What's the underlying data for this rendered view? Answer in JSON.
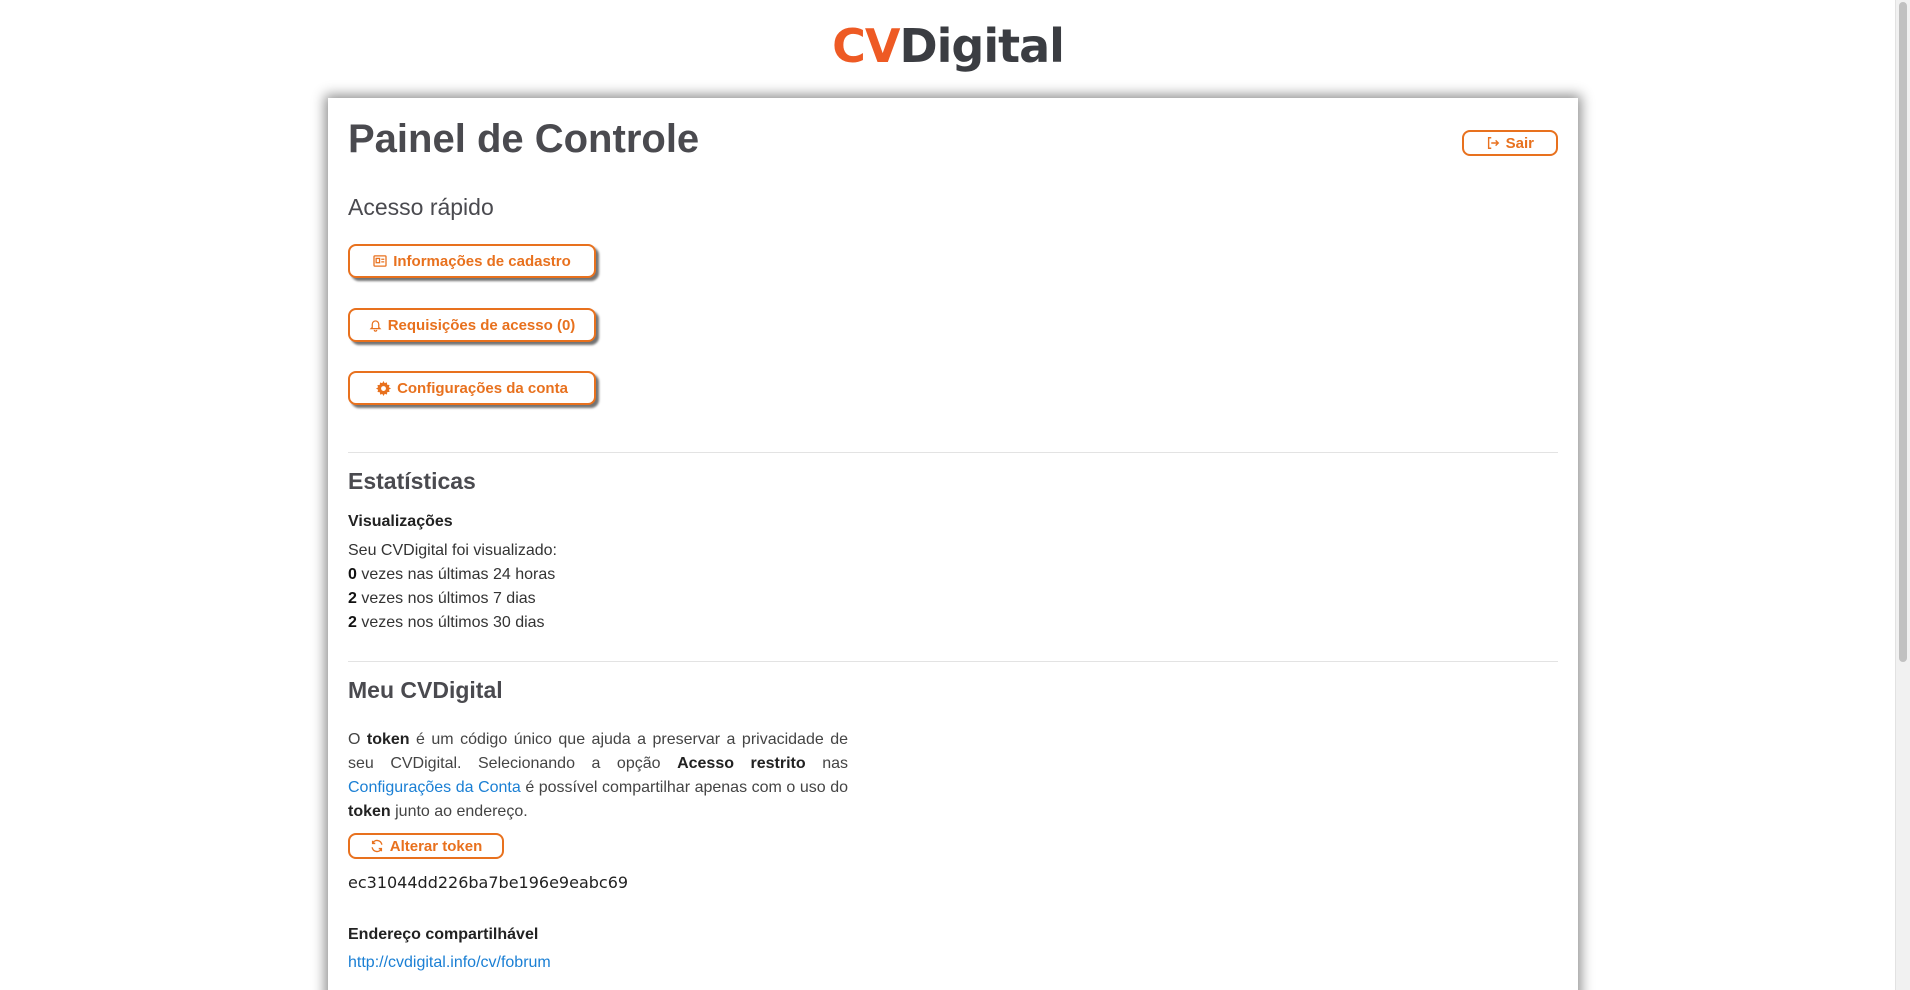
{
  "logo": {
    "part1": "CV",
    "part2": "Digital"
  },
  "header": {
    "title": "Painel de Controle",
    "logout_label": "Sair"
  },
  "quick_access": {
    "title": "Acesso rápido",
    "buttons": [
      {
        "label": "Informações de cadastro",
        "icon": "id-card-icon"
      },
      {
        "label": "Requisições de acesso (0)",
        "icon": "bell-icon"
      },
      {
        "label": "Configurações da conta",
        "icon": "gear-icon"
      }
    ]
  },
  "stats": {
    "title": "Estatísticas",
    "views_label": "Visualizações",
    "intro": "Seu CVDigital foi visualizado:",
    "rows": [
      {
        "count": "0",
        "text": " vezes nas últimas 24 horas"
      },
      {
        "count": "2",
        "text": " vezes nos últimos 7 dias"
      },
      {
        "count": "2",
        "text": " vezes nos últimos 30 dias"
      }
    ]
  },
  "my_cv": {
    "title": "Meu CVDigital",
    "paragraph": {
      "p1": "O ",
      "b1": "token",
      "p2": " é um código único que ajuda a preservar a privacidade de seu CVDigital. Selecionando a opção ",
      "b2": "Acesso restrito",
      "p3": " nas ",
      "link": "Configurações da Conta",
      "p4": " é possível compartilhar apenas com o uso do ",
      "b3": "token",
      "p5": " junto ao endereço."
    },
    "change_token_label": "Alterar token",
    "token_value": "ec31044dd226ba7be196e9eabc69",
    "share_label": "Endereço compartilhável",
    "share_url": "http://cvdigital.info/cv/fobrum"
  },
  "colors": {
    "accent": "#e8711e",
    "logo_cv": "#ee5a24",
    "logo_text": "#3b3d42",
    "link": "#1a7fd4"
  }
}
